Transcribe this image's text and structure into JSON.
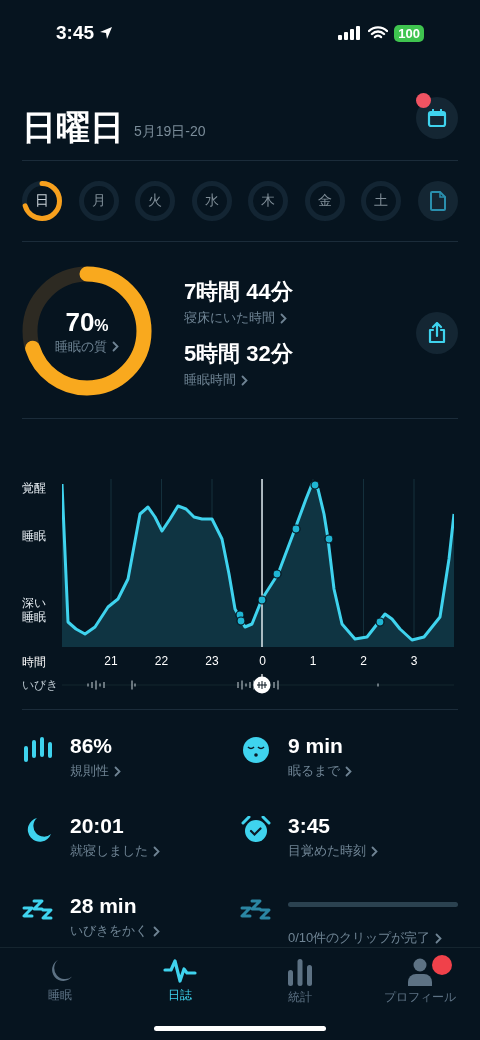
{
  "status_bar": {
    "time": "3:45",
    "battery": "100"
  },
  "header": {
    "title": "日曜日",
    "date_range": "5月19日-20",
    "calendar_badge": true
  },
  "days": [
    {
      "label": "日",
      "selected": true
    },
    {
      "label": "月",
      "selected": false
    },
    {
      "label": "火",
      "selected": false
    },
    {
      "label": "水",
      "selected": false
    },
    {
      "label": "木",
      "selected": false
    },
    {
      "label": "金",
      "selected": false
    },
    {
      "label": "土",
      "selected": false
    }
  ],
  "summary": {
    "quality": {
      "value": "70",
      "unit": "%",
      "label": "睡眠の質"
    },
    "stats": [
      {
        "value": "7時間 44分",
        "label": "寝床にいた時間"
      },
      {
        "value": "5時間 32分",
        "label": "睡眠時間"
      }
    ]
  },
  "chart": {
    "y_labels": [
      "覚醒",
      "睡眠",
      "深い睡眠"
    ],
    "x_title": "時間",
    "x_labels": [
      "21",
      "22",
      "23",
      "0",
      "1",
      "2",
      "3"
    ],
    "snore_label": "いびき"
  },
  "metrics": [
    {
      "kind": "stat",
      "value": "86%",
      "label": "規則性"
    },
    {
      "kind": "stat",
      "value": "9 min",
      "label": "眠るまで"
    },
    {
      "kind": "stat",
      "value": "20:01",
      "label": "就寝しました"
    },
    {
      "kind": "stat",
      "value": "3:45",
      "label": "目覚めた時刻"
    },
    {
      "kind": "stat",
      "value": "28 min",
      "label": "いびきをかく"
    },
    {
      "kind": "progress",
      "label": "0/10件のクリップが完了"
    }
  ],
  "tab_bar": [
    {
      "label": "睡眠",
      "selected": false,
      "badge": false
    },
    {
      "label": "日誌",
      "selected": true,
      "badge": false
    },
    {
      "label": "統計",
      "selected": false,
      "badge": false
    },
    {
      "label": "プロフィール",
      "selected": false,
      "badge": true
    }
  ]
}
